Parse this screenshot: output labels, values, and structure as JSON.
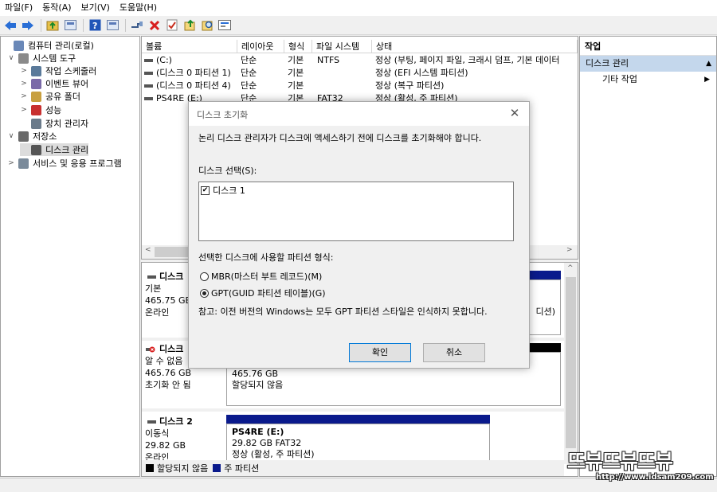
{
  "menu": [
    "파일(F)",
    "동작(A)",
    "보기(V)",
    "도움말(H)"
  ],
  "toolbar": {
    "icons": [
      "back-icon",
      "forward-icon",
      "up-folder-icon",
      "console-tree-icon",
      "help-icon",
      "view-icon",
      "connect-icon",
      "delete-icon",
      "properties-icon",
      "export-icon",
      "search-icon",
      "list-icon"
    ],
    "colors": {
      "arrow": "#2a6fd6",
      "delete": "#d81e1e",
      "help": "#2156b8"
    }
  },
  "tree": {
    "items": [
      {
        "label": "컴퓨터 관리(로컬)",
        "icon": "computer-management-icon",
        "twisty": ""
      },
      {
        "label": "시스템 도구",
        "icon": "system-tools-icon",
        "twisty": "open"
      },
      {
        "label": "작업 스케줄러",
        "icon": "task-scheduler-icon",
        "twisty": "closed"
      },
      {
        "label": "이벤트 뷰어",
        "icon": "event-viewer-icon",
        "twisty": "closed"
      },
      {
        "label": "공유 폴더",
        "icon": "shared-folders-icon",
        "twisty": "closed"
      },
      {
        "label": "성능",
        "icon": "performance-icon",
        "twisty": "closed"
      },
      {
        "label": "장치 관리자",
        "icon": "device-manager-icon",
        "twisty": ""
      },
      {
        "label": "저장소",
        "icon": "storage-icon",
        "twisty": "open"
      },
      {
        "label": "디스크 관리",
        "icon": "disk-management-icon",
        "twisty": ""
      },
      {
        "label": "서비스 및 응용 프로그램",
        "icon": "services-icon",
        "twisty": "closed"
      }
    ]
  },
  "volumes": {
    "headers": [
      "볼륨",
      "레이아웃",
      "형식",
      "파일 시스템",
      "상태"
    ],
    "rows": [
      {
        "volume": "(C:)",
        "layout": "단순",
        "type": "기본",
        "fs": "NTFS",
        "status": "정상 (부팅, 페이지 파일, 크래시 덤프, 기본 데이터"
      },
      {
        "volume": "(디스크 0 파티션 1)",
        "layout": "단순",
        "type": "기본",
        "fs": "",
        "status": "정상 (EFI 시스템 파티션)"
      },
      {
        "volume": "(디스크 0 파티션 4)",
        "layout": "단순",
        "type": "기본",
        "fs": "",
        "status": "정상 (복구 파티션)"
      },
      {
        "volume": "PS4RE (E:)",
        "layout": "단순",
        "type": "기본",
        "fs": "FAT32",
        "status": "정상 (활성, 주 파티션)"
      }
    ]
  },
  "disks": {
    "disk0": {
      "name": "디스크",
      "type": "기본",
      "size": "465.75 GB",
      "state": "온라인",
      "part_tail": "디션)"
    },
    "disk1": {
      "name": "디스크",
      "type": "알 수 없음",
      "size": "465.76 GB",
      "state": "초기화 안 됨",
      "part_size": "465.76 GB",
      "part_state": "할당되지 않음"
    },
    "disk2": {
      "name": "디스크 2",
      "type": "이동식",
      "size": "29.82 GB",
      "state": "온라인",
      "part_name": "PS4RE  (E:)",
      "part_size": "29.82 GB FAT32",
      "part_state": "정상 (활성, 주 파티션)"
    },
    "colors": {
      "primary": "#0a1a8c",
      "unallocated": "#000000"
    }
  },
  "legend": {
    "unallocated": "할당되지 않음",
    "primary": "주 파티션"
  },
  "actions": {
    "title": "작업",
    "section": "디스크 관리",
    "more": "기타 작업"
  },
  "dialog": {
    "title": "디스크 초기화",
    "message": "논리 디스크 관리자가 디스크에 액세스하기 전에 디스크를 초기화해야 합니다.",
    "select_label": "디스크 선택(S):",
    "disk_item": "디스크 1",
    "disk_checked": true,
    "partition_label": "선택한 디스크에 사용할 파티션 형식:",
    "mbr": "MBR(마스터 부트 레코드)(M)",
    "gpt": "GPT(GUID 파티션 테이블)(G)",
    "selected": "gpt",
    "note": "참고: 이전 버전의 Windows는 모두 GPT 파티션 스타일은 인식하지 못합니다.",
    "ok": "확인",
    "cancel": "취소"
  },
  "watermark": {
    "logo": "뜨뷰뜨뷰뜨뷰",
    "url": "http://www.idsam209.com"
  }
}
